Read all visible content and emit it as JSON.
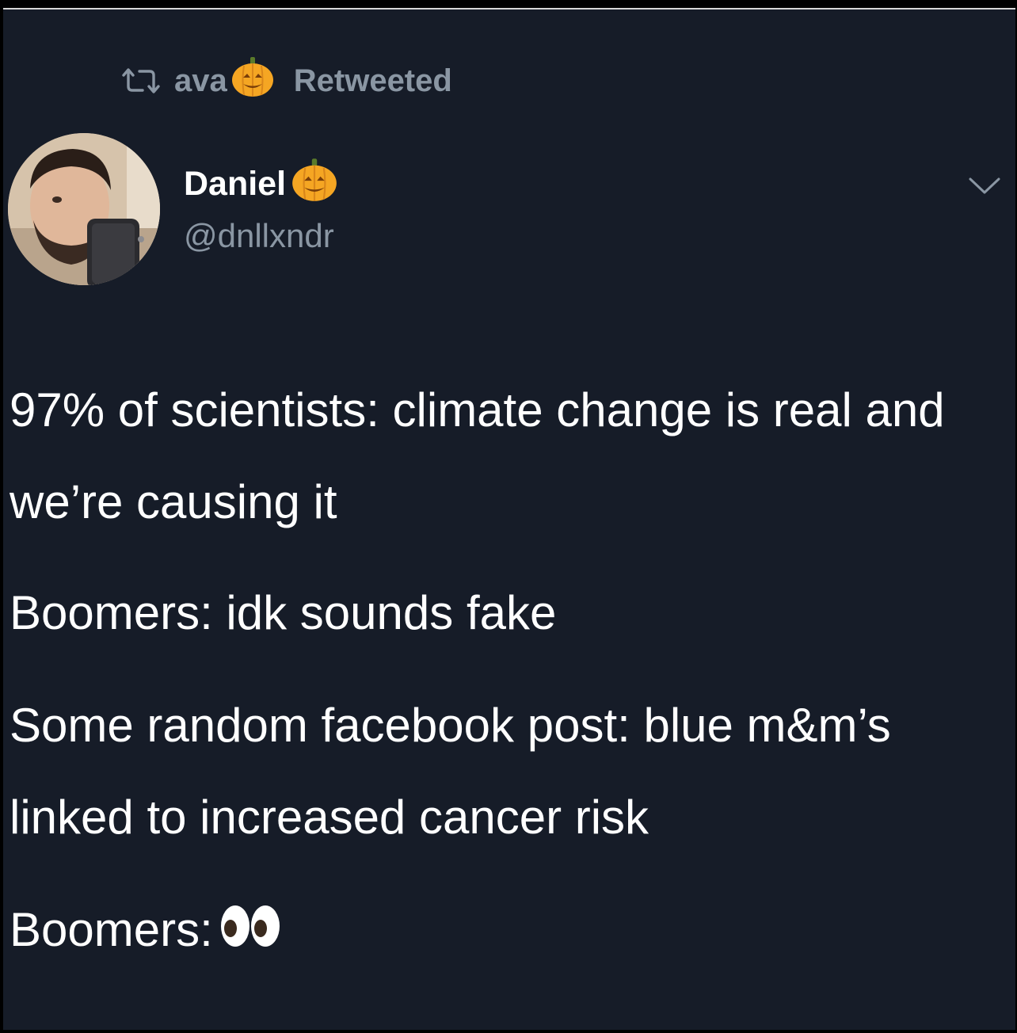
{
  "retweet": {
    "user": "ava",
    "label": "Retweeted"
  },
  "author": {
    "name": "Daniel",
    "handle": "@dnllxndr",
    "name_emoji": "jack-o-lantern-icon",
    "avatar": "avatar-photo"
  },
  "tweet": {
    "lines": [
      "97% of scientists: climate change is real and we’re causing it",
      "Boomers: idk sounds fake",
      "Some random facebook post: blue m&m’s linked to increased cancer risk",
      "Boomers:"
    ],
    "trailing_emoji": "eyes-icon"
  },
  "colors": {
    "background": "#161c28",
    "primary_text": "#ffffff",
    "secondary_text": "#8a96a3",
    "pumpkin": "#f5a623"
  }
}
